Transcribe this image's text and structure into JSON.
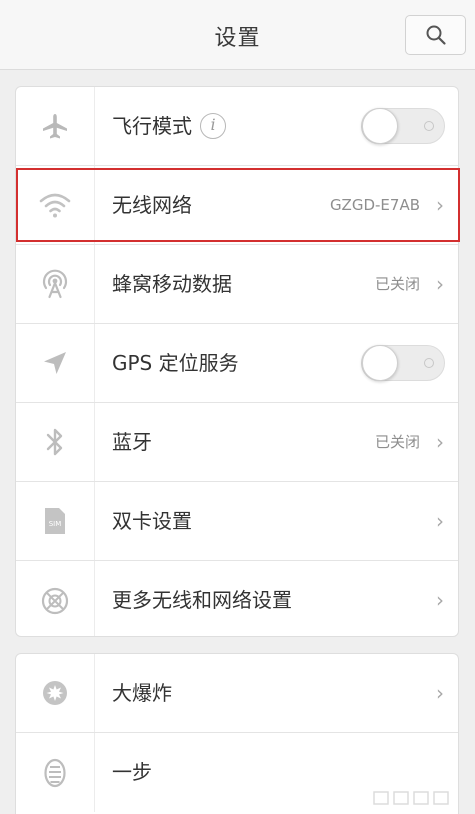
{
  "header": {
    "title": "设置",
    "search_icon": "search-icon"
  },
  "colors": {
    "highlight": "#d32f2f",
    "background": "#efefef",
    "card": "#ffffff"
  },
  "section1": {
    "airplane": {
      "label": "飞行模式",
      "info_glyph": "i",
      "toggle_on": false,
      "icon": "airplane-icon"
    },
    "wifi": {
      "label": "无线网络",
      "value": "GZGD-E7AB",
      "icon": "wifi-icon"
    },
    "cellular": {
      "label": "蜂窝移动数据",
      "value": "已关闭",
      "icon": "cellular-antenna-icon"
    },
    "gps": {
      "label": "GPS 定位服务",
      "toggle_on": false,
      "icon": "location-arrow-icon"
    },
    "bluetooth": {
      "label": "蓝牙",
      "value": "已关闭",
      "icon": "bluetooth-icon"
    },
    "dualsim": {
      "label": "双卡设置",
      "icon": "sim-card-icon",
      "icon_text": "SIM"
    },
    "more": {
      "label": "更多无线和网络设置",
      "icon": "network-globe-icon"
    }
  },
  "section2": {
    "boom": {
      "label": "大爆炸",
      "icon": "burst-icon"
    },
    "onestep": {
      "label": "一步",
      "icon": "one-step-icon"
    }
  },
  "chevron": "›"
}
